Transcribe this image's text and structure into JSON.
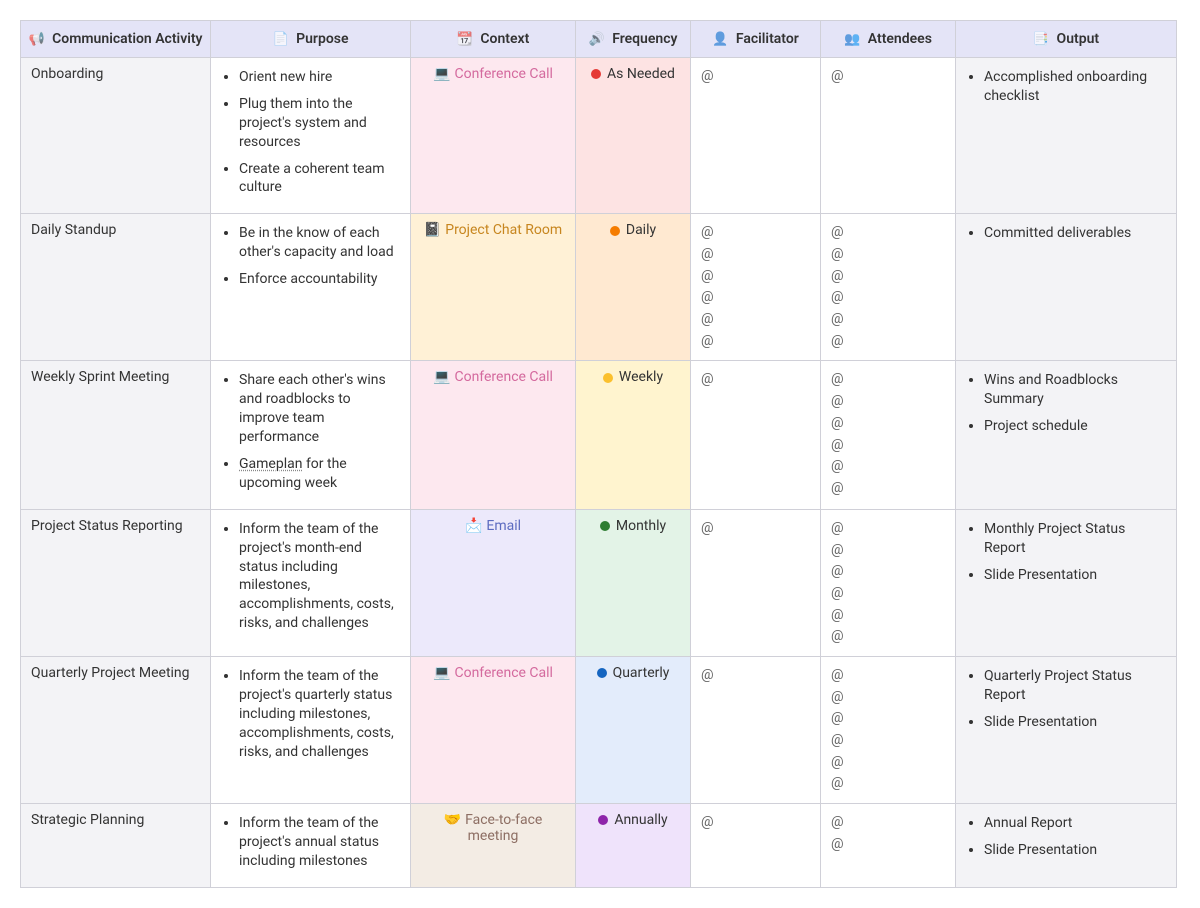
{
  "headers": {
    "activity": {
      "icon": "📢",
      "label": "Communication Activity"
    },
    "purpose": {
      "icon": "📄",
      "label": "Purpose"
    },
    "context": {
      "icon": "📆",
      "label": "Context"
    },
    "frequency": {
      "icon": "🔊",
      "label": "Frequency"
    },
    "facilitator": {
      "icon": "👤",
      "label": "Facilitator"
    },
    "attendees": {
      "icon": "👥",
      "label": "Attendees"
    },
    "output": {
      "icon": "📑",
      "label": "Output"
    }
  },
  "context_types": {
    "conference_call": {
      "icon": "💻",
      "label": "Conference Call",
      "label_class": "ctx-label-pink",
      "bg_class": "bg-pink"
    },
    "project_chat": {
      "icon": "📓",
      "label": "Project Chat Room",
      "label_class": "ctx-label-orange",
      "bg_class": "bg-orange"
    },
    "email": {
      "icon": "📩",
      "label": "Email",
      "label_class": "ctx-label-blue",
      "bg_class": "bg-lav"
    },
    "face_to_face": {
      "icon": "🤝",
      "label": "Face-to-face meeting",
      "label_class": "ctx-label-brown",
      "bg_class": "bg-tan"
    }
  },
  "frequency_types": {
    "as_needed": {
      "label": "As Needed",
      "dot_class": "dot-red",
      "bg_class": "freq-bg-red"
    },
    "daily": {
      "label": "Daily",
      "dot_class": "dot-orange",
      "bg_class": "freq-bg-orange"
    },
    "weekly": {
      "label": "Weekly",
      "dot_class": "dot-yellow",
      "bg_class": "freq-bg-yellow"
    },
    "monthly": {
      "label": "Monthly",
      "dot_class": "dot-green",
      "bg_class": "freq-bg-green"
    },
    "quarterly": {
      "label": "Quarterly",
      "dot_class": "dot-blue",
      "bg_class": "freq-bg-blue"
    },
    "annually": {
      "label": "Annually",
      "dot_class": "dot-purple",
      "bg_class": "freq-bg-purple"
    }
  },
  "rows": [
    {
      "activity": "Onboarding",
      "purpose": [
        "Orient new hire",
        "Plug them into the project's system and resources",
        "Create a coherent team culture"
      ],
      "context": "conference_call",
      "frequency": "as_needed",
      "facilitator_count": 1,
      "attendee_count": 1,
      "output": [
        "Accomplished onboarding checklist"
      ]
    },
    {
      "activity": "Daily Standup",
      "purpose": [
        "Be in the know of each other's capacity and load",
        "Enforce accountability"
      ],
      "context": "project_chat",
      "frequency": "daily",
      "facilitator_count": 6,
      "attendee_count": 6,
      "output": [
        "Committed deliverables"
      ]
    },
    {
      "activity": "Weekly Sprint Meeting",
      "purpose": [
        "Share each other's wins and roadblocks to improve team performance",
        "{{u:Gameplan}} for the upcoming week"
      ],
      "context": "conference_call",
      "frequency": "weekly",
      "facilitator_count": 1,
      "attendee_count": 6,
      "output": [
        "Wins and Roadblocks Summary",
        "Project schedule"
      ]
    },
    {
      "activity": "Project Status Reporting",
      "purpose": [
        "Inform the team of the project's month-end status including milestones, accomplishments, costs, risks, and challenges"
      ],
      "context": "email",
      "frequency": "monthly",
      "facilitator_count": 1,
      "attendee_count": 6,
      "output": [
        "Monthly Project Status Report",
        "Slide Presentation"
      ]
    },
    {
      "activity": "Quarterly Project Meeting",
      "purpose": [
        "Inform the team of the project's quarterly status including milestones, accomplishments, costs, risks, and challenges"
      ],
      "context": "conference_call",
      "frequency": "quarterly",
      "facilitator_count": 1,
      "attendee_count": 6,
      "output": [
        "Quarterly Project Status Report",
        "Slide Presentation"
      ]
    },
    {
      "activity": "Strategic Planning",
      "purpose": [
        "Inform the team of the project's annual status including milestones"
      ],
      "context": "face_to_face",
      "frequency": "annually",
      "facilitator_count": 1,
      "attendee_count": 2,
      "output": [
        "Annual Report",
        "Slide Presentation"
      ]
    }
  ],
  "mention_glyph": "@"
}
